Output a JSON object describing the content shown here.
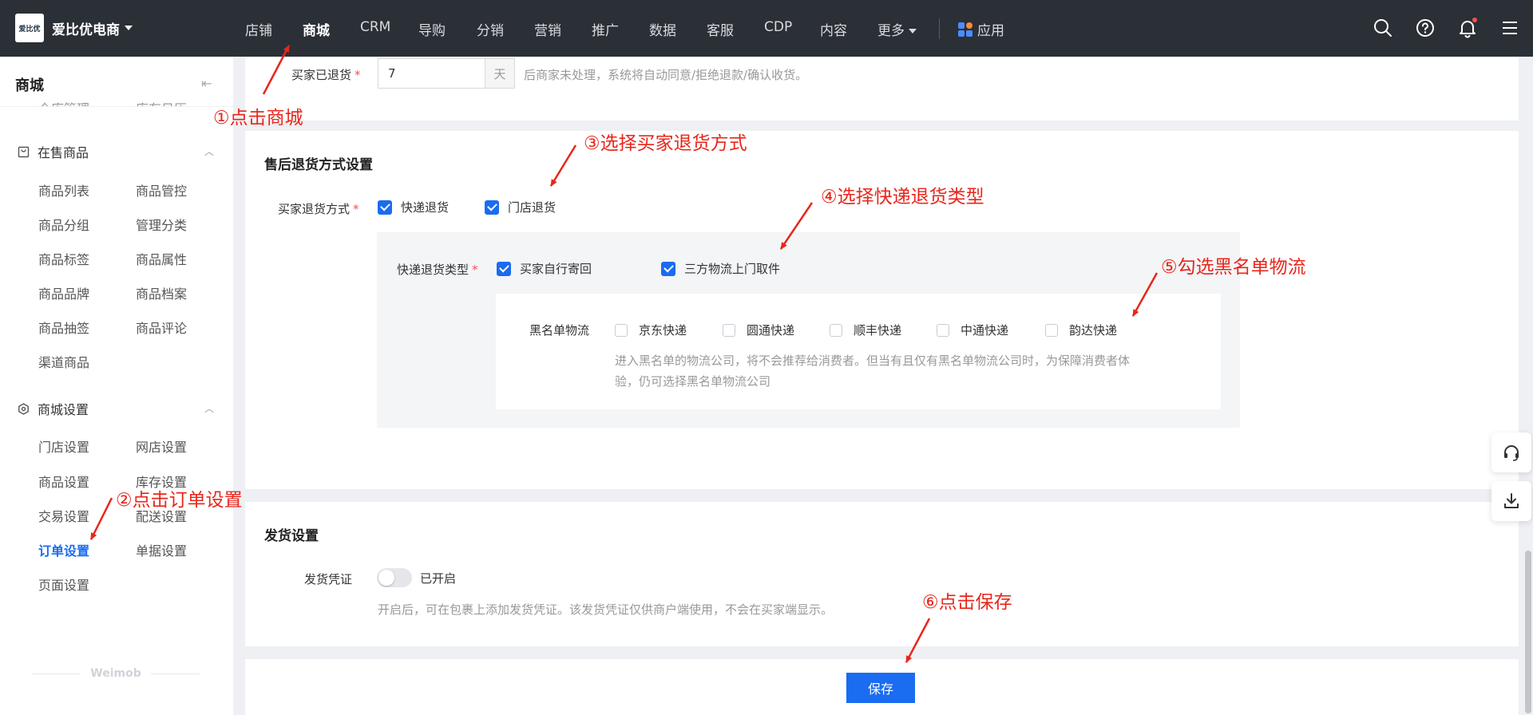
{
  "topbar": {
    "brand_logo_text": "爱比优",
    "brand_name": "爱比优电商",
    "nav": [
      "店铺",
      "商城",
      "CRM",
      "导购",
      "分销",
      "营销",
      "推广",
      "数据",
      "客服",
      "CDP",
      "内容",
      "更多"
    ],
    "active_nav": "商城",
    "apps_label": "应用",
    "icons": [
      "search-icon",
      "help-icon",
      "bell-icon",
      "menu-icon"
    ]
  },
  "sidebar": {
    "title": "商城",
    "cut_items": [
      "仓库管理",
      "库存日历"
    ],
    "groups": [
      {
        "label": "在售商品",
        "icon": "shop-bag-icon",
        "items": [
          "商品列表",
          "商品管控",
          "商品分组",
          "管理分类",
          "商品标签",
          "商品属性",
          "商品品牌",
          "商品档案",
          "商品抽签",
          "商品评论",
          "渠道商品"
        ]
      },
      {
        "label": "商城设置",
        "icon": "settings-hexagon-icon",
        "items": [
          "门店设置",
          "网店设置",
          "商品设置",
          "库存设置",
          "交易设置",
          "配送设置",
          "订单设置",
          "单据设置",
          "页面设置"
        ]
      }
    ],
    "active_item": "订单设置",
    "footer": "Weimob"
  },
  "return_days": {
    "label": "买家已退货",
    "value": "7",
    "unit": "天",
    "hint": "后商家未处理，系统将自动同意/拒绝退款/确认收货。"
  },
  "aftersale": {
    "section_title": "售后退货方式设置",
    "method_label": "买家退货方式",
    "methods": [
      {
        "label": "快递退货",
        "checked": true
      },
      {
        "label": "门店退货",
        "checked": true
      }
    ],
    "express_type_label": "快递退货类型",
    "express_types": [
      {
        "label": "买家自行寄回",
        "checked": true
      },
      {
        "label": "三方物流上门取件",
        "checked": true
      }
    ],
    "blacklist_label": "黑名单物流",
    "couriers": [
      {
        "label": "京东快递",
        "checked": false
      },
      {
        "label": "圆通快递",
        "checked": false
      },
      {
        "label": "顺丰快递",
        "checked": false
      },
      {
        "label": "中通快递",
        "checked": false
      },
      {
        "label": "韵达快递",
        "checked": false
      }
    ],
    "blacklist_hint_line1": "进入黑名单的物流公司，将不会推荐给消费者。但当有且仅有黑名单物流公司时，为保障消费者体",
    "blacklist_hint_line2": "验，仍可选择黑名单物流公司"
  },
  "shipping": {
    "section_title": "发货设置",
    "voucher_label": "发货凭证",
    "toggle_on": false,
    "toggle_text": "已开启",
    "hint": "开启后，可在包裹上添加发货凭证。该发货凭证仅供商户端使用，不会在买家端显示。"
  },
  "save_label": "保存",
  "float_buttons": [
    "headset-icon",
    "download-icon"
  ],
  "annotations": [
    "①点击商城",
    "②点击订单设置",
    "③选择买家退货方式",
    "④选择快递退货类型",
    "⑤勾选黑名单物流",
    "⑥点击保存"
  ],
  "colors": {
    "topbar": "#2b2f36",
    "accent": "#1a6cf0",
    "annotation": "#e8261c",
    "required": "#ff4d4f"
  }
}
